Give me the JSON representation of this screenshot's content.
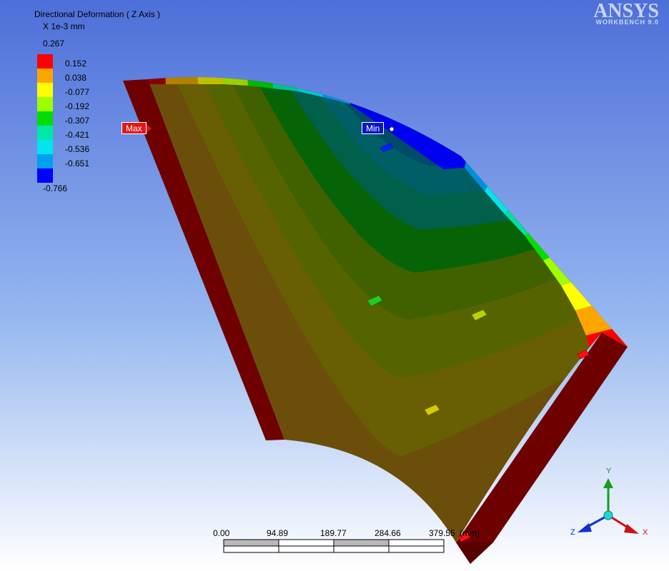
{
  "legend": {
    "title": "Directional Deformation ( Z Axis )",
    "unit": "X 1e-3 mm",
    "max": "0.267",
    "min": "-0.766",
    "labels": [
      "0.152",
      "0.038",
      "-0.077",
      "-0.192",
      "-0.307",
      "-0.421",
      "-0.536",
      "-0.651"
    ],
    "colors": [
      "#ff0000",
      "#ffa500",
      "#ffff00",
      "#9bff00",
      "#00dd00",
      "#00e8a8",
      "#00e5f0",
      "#009ff0",
      "#0000ff"
    ]
  },
  "markers": {
    "max": "Max",
    "min": "Min"
  },
  "brand": {
    "name": "ANSYS",
    "sub": "WORKBENCH 9.0"
  },
  "scale_bar": {
    "ticks": [
      "0.00",
      "94.89",
      "189.77",
      "284.66",
      "379.55"
    ],
    "unit": "(mm)"
  },
  "triad": {
    "x": "X",
    "y": "Y",
    "z": "Z"
  },
  "colors": {
    "background_top": "#4d6fd9",
    "background_bottom": "#ffffff",
    "side_face": "#6e0000"
  }
}
